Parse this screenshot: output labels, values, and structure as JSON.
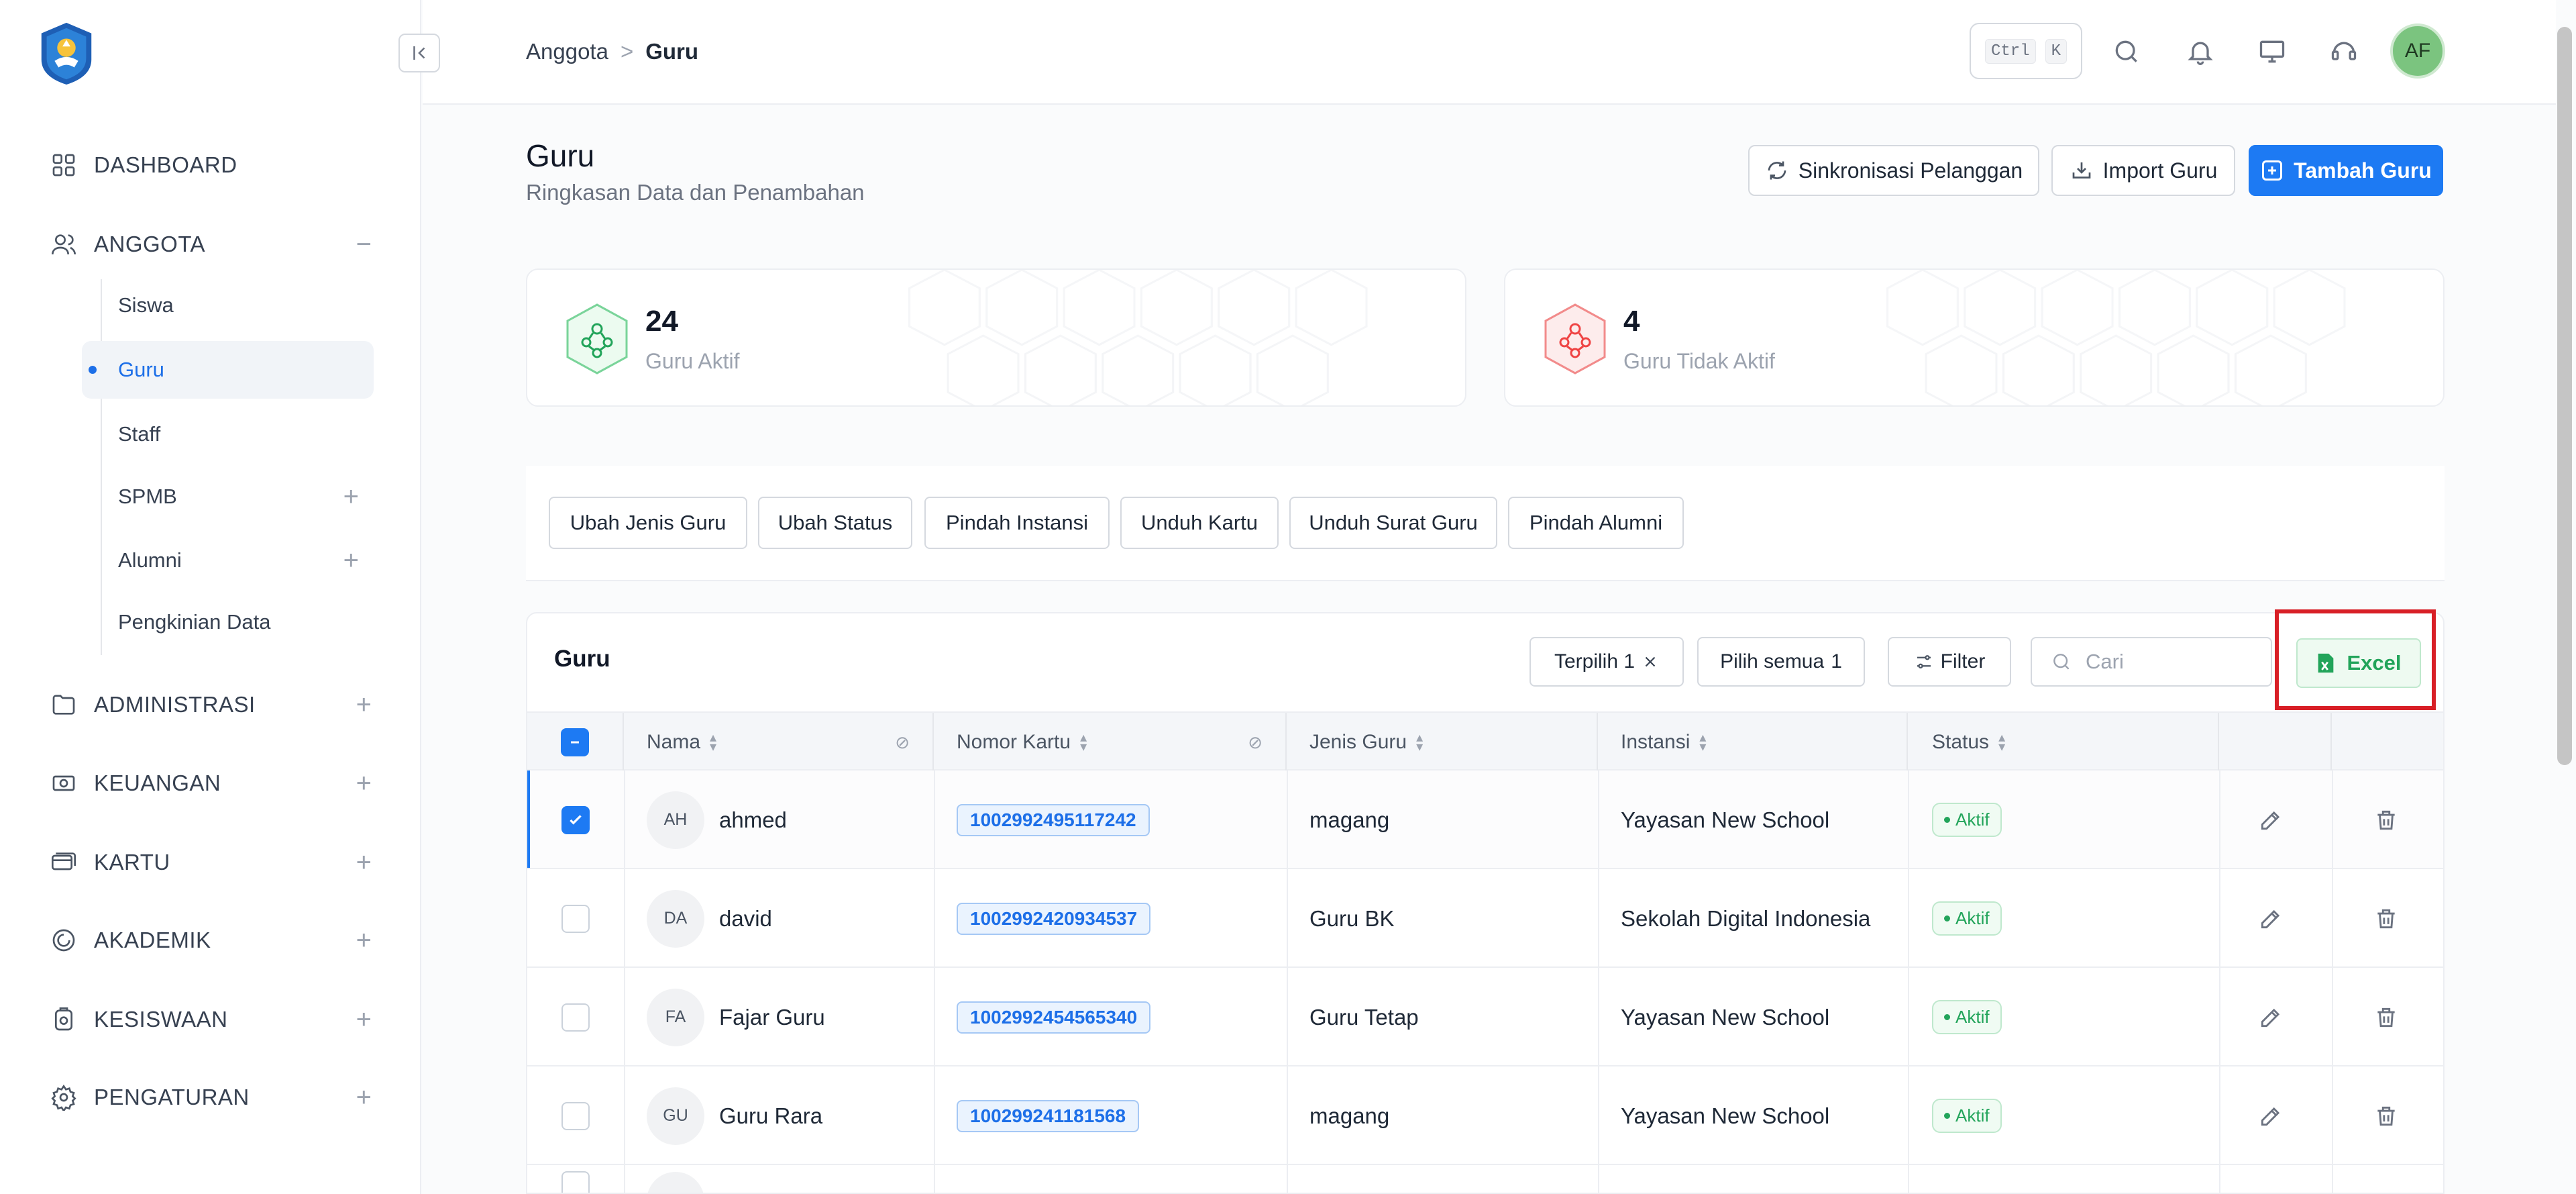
{
  "sidebar": {
    "items": [
      {
        "label": "DASHBOARD",
        "icon": "grid-icon"
      },
      {
        "label": "ANGGOTA",
        "icon": "users-icon",
        "toggle": "−"
      },
      {
        "label": "ADMINISTRASI",
        "icon": "folder-icon",
        "toggle": "+"
      },
      {
        "label": "KEUANGAN",
        "icon": "money-icon",
        "toggle": "+"
      },
      {
        "label": "KARTU",
        "icon": "card-icon",
        "toggle": "+"
      },
      {
        "label": "AKADEMIK",
        "icon": "academic-icon",
        "toggle": "+"
      },
      {
        "label": "KESISWAAN",
        "icon": "student-icon",
        "toggle": "+"
      },
      {
        "label": "PENGATURAN",
        "icon": "settings-icon",
        "toggle": "+"
      }
    ],
    "sub_items": [
      {
        "label": "Siswa"
      },
      {
        "label": "Guru",
        "active": true
      },
      {
        "label": "Staff"
      },
      {
        "label": "SPMB",
        "toggle": "+"
      },
      {
        "label": "Alumni",
        "toggle": "+"
      },
      {
        "label": "Pengkinian Data"
      }
    ]
  },
  "breadcrumb": {
    "parent": "Anggota",
    "sep": ">",
    "current": "Guru"
  },
  "topbar": {
    "kbd_1": "Ctrl",
    "kbd_2": "K",
    "avatar": "AF"
  },
  "header": {
    "title": "Guru",
    "subtitle": "Ringkasan Data dan Penambahan",
    "sync_label": "Sinkronisasi Pelanggan",
    "import_label": "Import Guru",
    "add_label": "Tambah Guru"
  },
  "stats": {
    "active_value": "24",
    "active_label": "Guru Aktif",
    "inactive_value": "4",
    "inactive_label": "Guru Tidak Aktif"
  },
  "actions": [
    "Ubah Jenis Guru",
    "Ubah Status",
    "Pindah Instansi",
    "Unduh Kartu",
    "Unduh Surat Guru",
    "Pindah Alumni"
  ],
  "table": {
    "title": "Guru",
    "selected_label": "Terpilih 1",
    "select_all_label": "Pilih semua",
    "select_all_count": "1",
    "filter_label": "Filter",
    "search_placeholder": "Cari",
    "excel_label": "Excel",
    "columns": [
      "Nama",
      "Nomor Kartu",
      "Jenis Guru",
      "Instansi",
      "Status"
    ],
    "rows": [
      {
        "initials": "AH",
        "name": "ahmed",
        "card": "1002992495117242",
        "type": "magang",
        "institution": "Yayasan New School",
        "status": "Aktif",
        "checked": true
      },
      {
        "initials": "DA",
        "name": "david",
        "card": "1002992420934537",
        "type": "Guru BK",
        "institution": "Sekolah Digital Indonesia",
        "status": "Aktif",
        "checked": false
      },
      {
        "initials": "FA",
        "name": "Fajar Guru",
        "card": "1002992454565340",
        "type": "Guru Tetap",
        "institution": "Yayasan New School",
        "status": "Aktif",
        "checked": false
      },
      {
        "initials": "GU",
        "name": "Guru Rara",
        "card": "100299241181568",
        "type": "magang",
        "institution": "Yayasan New School",
        "status": "Aktif",
        "checked": false
      }
    ]
  },
  "colors": {
    "accent": "#1d7af3",
    "success": "#22a45a",
    "danger": "#ef4444",
    "highlight": "#d81f26"
  }
}
